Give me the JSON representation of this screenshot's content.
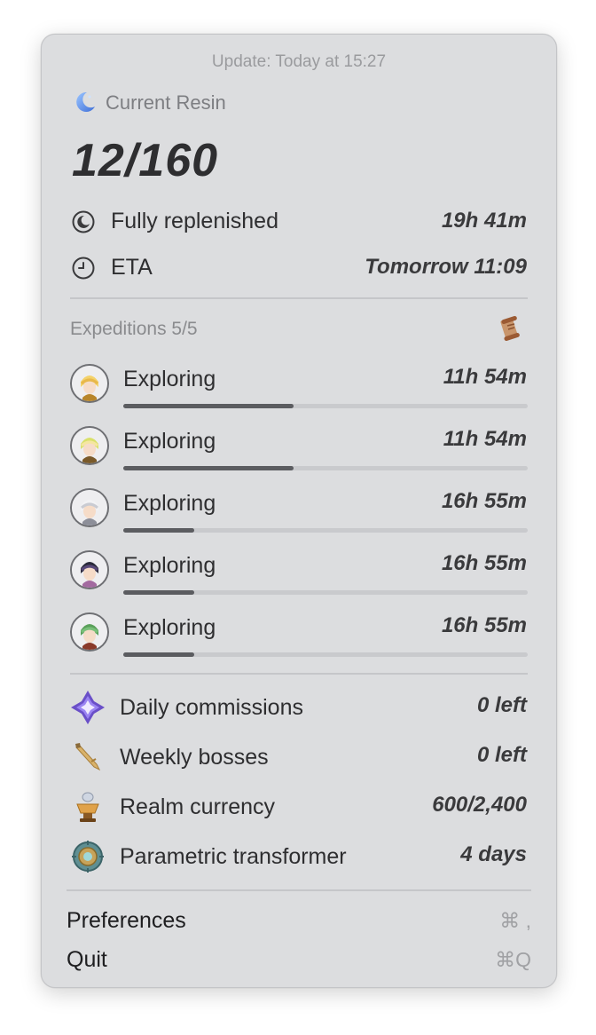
{
  "header": {
    "update_text": "Update: Today at 15:27"
  },
  "resin": {
    "title": "Current Resin",
    "value": "12/160",
    "rows": [
      {
        "label": "Fully replenished",
        "value": "19h 41m",
        "icon": "moon-outline-icon"
      },
      {
        "label": "ETA",
        "value": "Tomorrow 11:09",
        "icon": "clock-icon"
      }
    ]
  },
  "expeditions": {
    "title": "Expeditions 5/5",
    "items": [
      {
        "status": "Exploring",
        "time": "11h 54m",
        "progress": 0.42
      },
      {
        "status": "Exploring",
        "time": "11h 54m",
        "progress": 0.42
      },
      {
        "status": "Exploring",
        "time": "16h 55m",
        "progress": 0.175
      },
      {
        "status": "Exploring",
        "time": "16h 55m",
        "progress": 0.175
      },
      {
        "status": "Exploring",
        "time": "16h 55m",
        "progress": 0.175
      }
    ]
  },
  "tasks": [
    {
      "label": "Daily commissions",
      "value": "0 left",
      "icon": "commission-star-icon"
    },
    {
      "label": "Weekly bosses",
      "value": "0 left",
      "icon": "sword-icon"
    },
    {
      "label": "Realm currency",
      "value": "600/2,400",
      "icon": "teapot-icon"
    },
    {
      "label": "Parametric transformer",
      "value": "4 days",
      "icon": "transformer-icon"
    }
  ],
  "menu": {
    "preferences": {
      "label": "Preferences",
      "shortcut": "⌘ ,"
    },
    "quit": {
      "label": "Quit",
      "shortcut": "⌘Q"
    }
  }
}
